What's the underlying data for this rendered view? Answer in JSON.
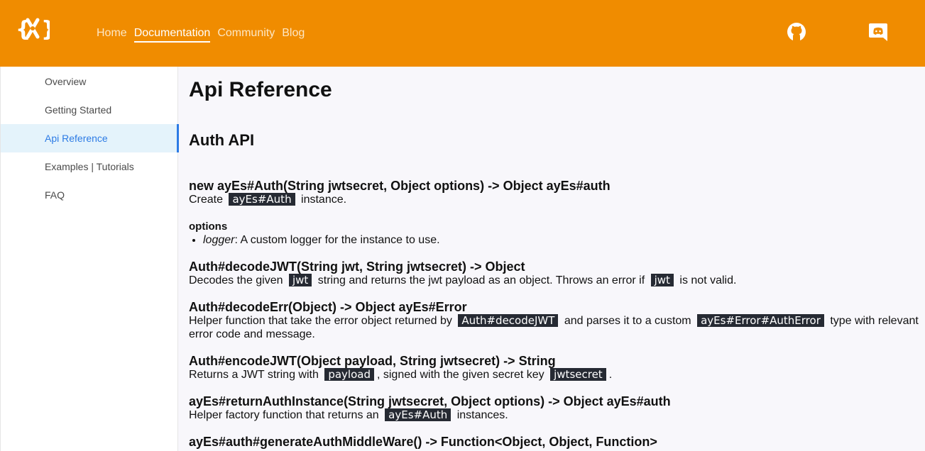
{
  "header": {
    "nav": [
      "Home",
      "Documentation",
      "Community",
      "Blog"
    ],
    "active_nav": "Documentation",
    "icons": [
      "logo-icon",
      "github-icon",
      "discord-icon"
    ],
    "brand_color": "#f08c00"
  },
  "sidebar": {
    "items": [
      "Overview",
      "Getting Started",
      "Api Reference",
      "Examples | Tutorials",
      "FAQ"
    ],
    "active": "Api Reference"
  },
  "main": {
    "title": "Api Reference",
    "section": "Auth API",
    "entries": [
      {
        "heading": "new ayEs#Auth(String jwtsecret, Object options) -> Object ayEs#auth",
        "desc": [
          "Create",
          "ayEs#Auth",
          "instance."
        ],
        "options_label": "options",
        "option_name": "logger",
        "option_desc": ": A custom logger for the instance to use."
      },
      {
        "heading": "Auth#decodeJWT(String jwt, String jwtsecret) -> Object",
        "desc": [
          "Decodes the given",
          "jwt",
          "string and returns the jwt payload as an object. Throws an error if",
          "jwt",
          "is not valid."
        ]
      },
      {
        "heading": "Auth#decodeErr(Object) -> Object ayEs#Error",
        "desc": [
          "Helper function that take the error object returned by",
          "Auth#decodeJWT",
          "and parses it to a custom",
          "ayEs#Error#AuthError",
          "type with relevant error code and message."
        ]
      },
      {
        "heading": "Auth#encodeJWT(Object payload, String jwtsecret) -> String",
        "desc": [
          "Returns a JWT string with",
          "payload",
          ", signed with the given secret key",
          "jwtsecret",
          "."
        ]
      },
      {
        "heading": "ayEs#returnAuthInstance(String jwtsecret, Object options) -> Object ayEs#auth",
        "desc": [
          "Helper factory function that returns an",
          "ayEs#Auth",
          "instances."
        ]
      },
      {
        "heading": "ayEs#auth#generateAuthMiddleWare() -> Function<Object, Object, Function>"
      }
    ]
  }
}
